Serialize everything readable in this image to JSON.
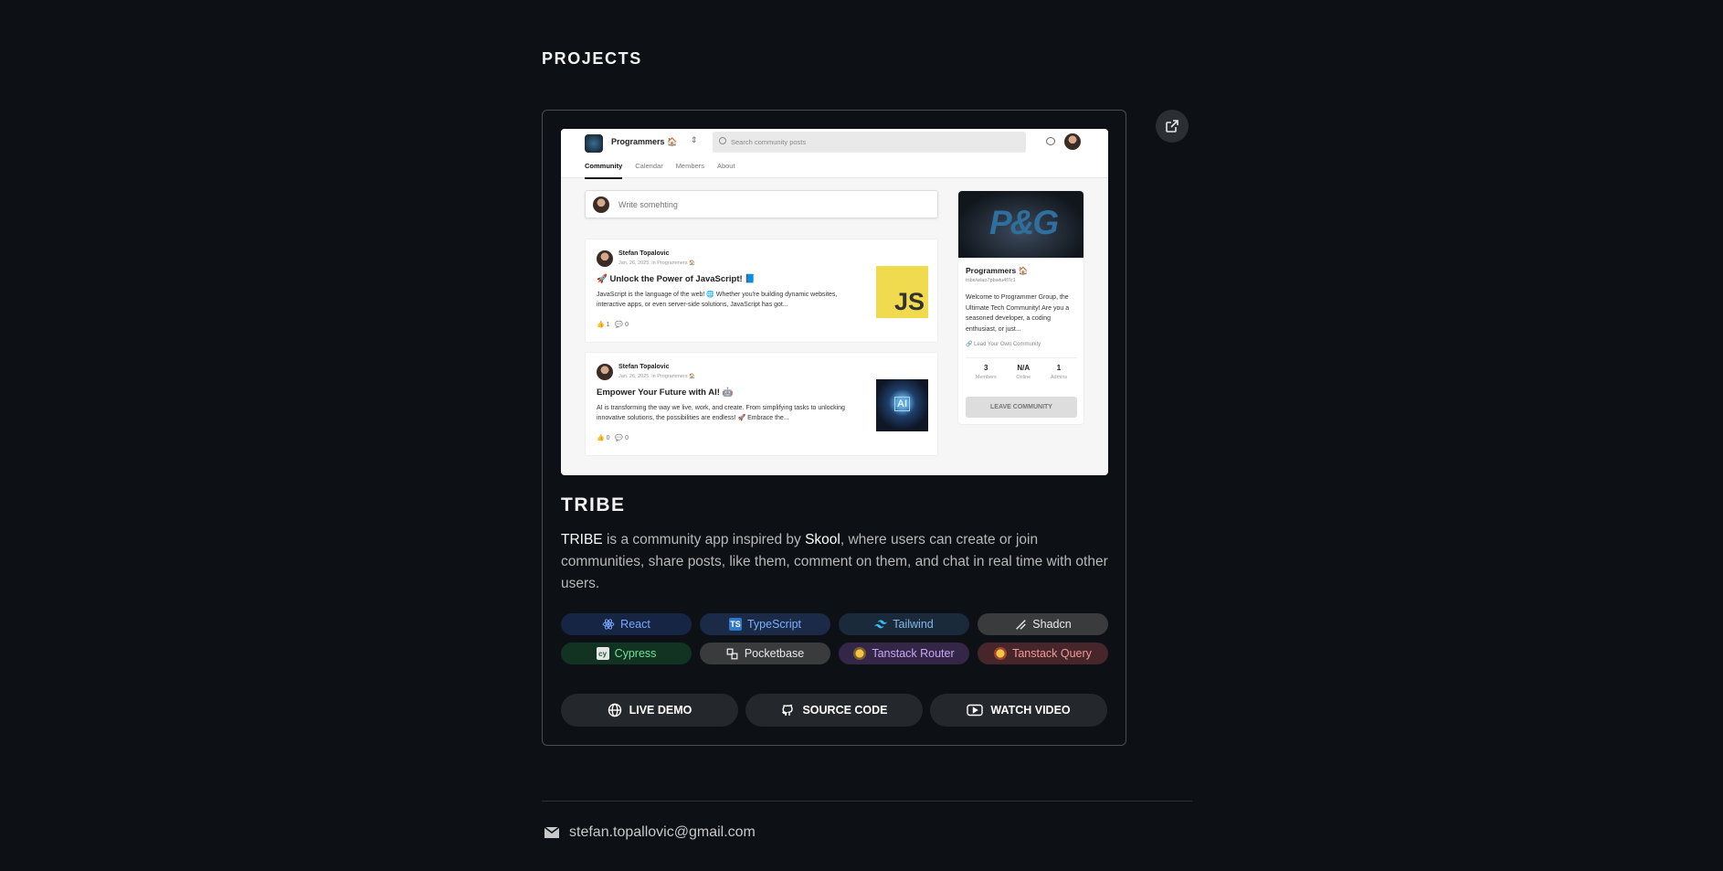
{
  "section": {
    "title": "PROJECTS"
  },
  "preview": {
    "group_name": "Programmers 🏠",
    "search_placeholder": "Search community posts",
    "tabs": [
      "Community",
      "Calendar",
      "Members",
      "About"
    ],
    "write_placeholder": "Write somehting",
    "posts": [
      {
        "author": "Stefan Topalovic",
        "meta": "Jan. 26, 2025. in Programmers 🏠",
        "title": "🚀 Unlock the Power of JavaScript! 📘",
        "body": "JavaScript is the language of the web! 🌐 Whether you're building dynamic websites, interactive apps, or even server-side solutions, JavaScript has got...",
        "likes": "1",
        "comments": "0",
        "thumb": "JS"
      },
      {
        "author": "Stefan Topalovic",
        "meta": "Jan. 26, 2025. in Programmers 🏠",
        "title": "Empower Your Future with AI! 🤖",
        "body": "AI is transforming the way we live, work, and create. From simplifying tasks to unlocking innovative solutions, the possibilities are endless! 🚀 Embrace the...",
        "likes": "0",
        "comments": "0",
        "thumb": "AI"
      }
    ],
    "sidebar": {
      "banner": "P&G",
      "name": "Programmers 🏠",
      "slug": "tribe/wlao7pbwtu4f7c1",
      "description": "Welcome to Programmer Group, the Ultimate Tech Community! Are you a seasoned developer, a coding enthusiast, or just...",
      "lead_link": "🔗 Lead Your Own Community",
      "stats": [
        {
          "value": "3",
          "label": "Members"
        },
        {
          "value": "N/A",
          "label": "Online"
        },
        {
          "value": "1",
          "label": "Admins"
        }
      ],
      "leave_button": "LEAVE COMMUNITY"
    }
  },
  "project": {
    "title": "TRIBE",
    "desc_name": "TRIBE",
    "desc_part1": " is a community app inspired by ",
    "desc_link": "Skool",
    "desc_part2": ", where users can create or join communities, share posts, like them, comment on them, and chat in real time with other users."
  },
  "tags": [
    {
      "label": "React",
      "icon": "react-icon",
      "bg": "#172544",
      "fg": "#7aa8ff"
    },
    {
      "label": "TypeScript",
      "icon": "typescript-icon",
      "bg": "#1b2a47",
      "fg": "#7ab0ff"
    },
    {
      "label": "Tailwind",
      "icon": "tailwind-icon",
      "bg": "#1a2a3a",
      "fg": "#82b8e8"
    },
    {
      "label": "Shadcn",
      "icon": "shadcn-icon",
      "bg": "#3a3b3d",
      "fg": "#eaeaea"
    },
    {
      "label": "Cypress",
      "icon": "cypress-icon",
      "bg": "#123322",
      "fg": "#6fe29a"
    },
    {
      "label": "Pocketbase",
      "icon": "pocketbase-icon",
      "bg": "#3a3b3d",
      "fg": "#eaeaea"
    },
    {
      "label": "Tanstack Router",
      "icon": "tanstack-router-icon",
      "bg": "#342647",
      "fg": "#c9a6f5"
    },
    {
      "label": "Tanstack Query",
      "icon": "tanstack-query-icon",
      "bg": "#46262a",
      "fg": "#f29a9a"
    }
  ],
  "actions": [
    {
      "label": "LIVE DEMO",
      "icon": "globe-icon"
    },
    {
      "label": "SOURCE CODE",
      "icon": "github-icon"
    },
    {
      "label": "WATCH VIDEO",
      "icon": "youtube-icon"
    }
  ],
  "contact": {
    "email": "stefan.topallovic@gmail.com",
    "icon": "mail-icon"
  }
}
